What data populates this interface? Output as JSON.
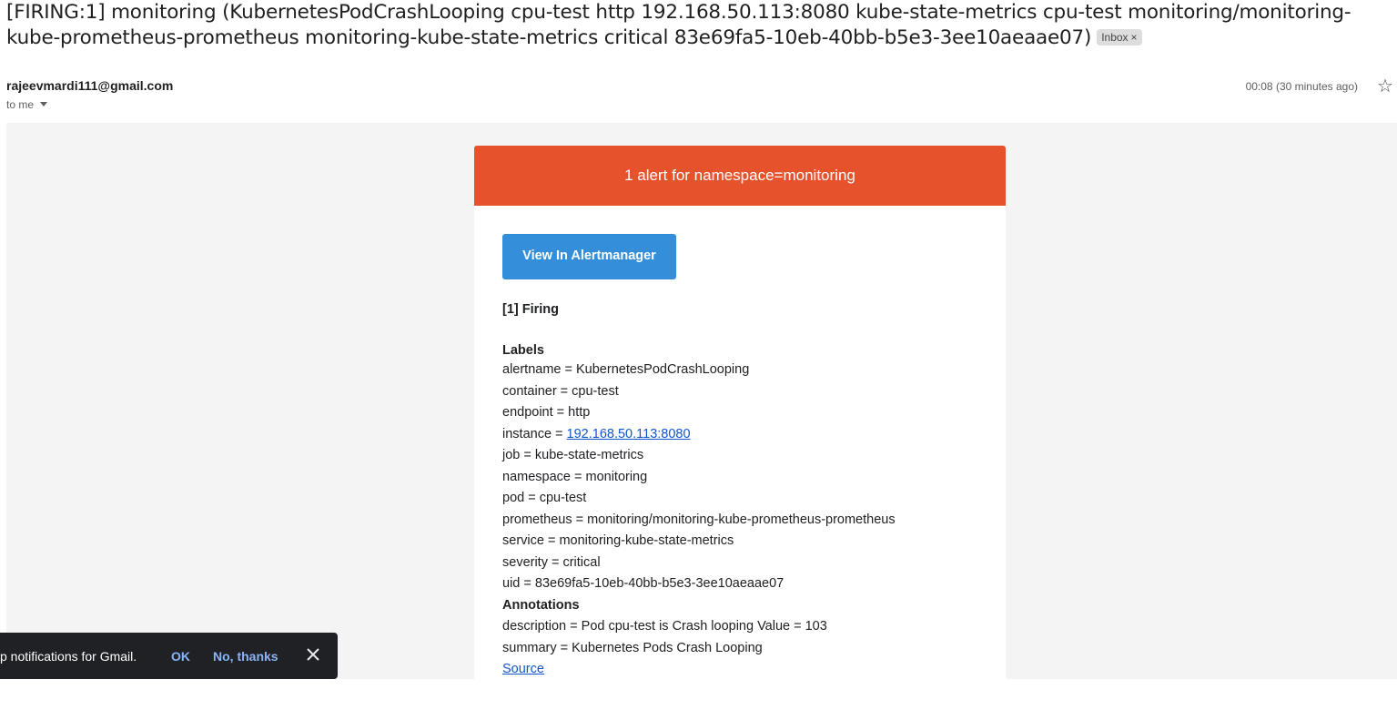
{
  "email": {
    "subject": "[FIRING:1] monitoring (KubernetesPodCrashLooping cpu-test http 192.168.50.113:8080 kube-state-metrics cpu-test monitoring/monitoring-kube-prometheus-prometheus monitoring-kube-state-metrics critical 83e69fa5-10eb-40bb-b5e3-3ee10aeaae07)",
    "label_chip": "Inbox",
    "label_chip_close": "×",
    "sender": "rajeevmardi111@gmail.com",
    "recipient": "to me",
    "time": "00:08 (30 minutes ago)",
    "star_icon": "☆"
  },
  "alert": {
    "header": "1 alert for namespace=monitoring",
    "header_color": "#e6522c",
    "button_label": "View In Alertmanager",
    "button_color": "#348eda",
    "firing_title": "[1] Firing",
    "labels_title": "Labels",
    "labels": [
      "alertname = KubernetesPodCrashLooping",
      "container = cpu-test",
      "endpoint = http",
      "instance = ",
      "job = kube-state-metrics",
      "namespace = monitoring",
      "pod = cpu-test",
      "prometheus = monitoring/monitoring-kube-prometheus-prometheus",
      "service = monitoring-kube-state-metrics",
      "severity = critical",
      "uid = 83e69fa5-10eb-40bb-b5e3-3ee10aeaae07"
    ],
    "instance_link": "192.168.50.113:8080",
    "annotations_title": "Annotations",
    "annotations": [
      "description = Pod cpu-test is Crash looping Value = 103",
      "summary = Kubernetes Pods Crash Looping"
    ],
    "source_link": "Source"
  },
  "toast": {
    "text": "p notifications for Gmail.",
    "ok": "OK",
    "no": "No, thanks"
  }
}
